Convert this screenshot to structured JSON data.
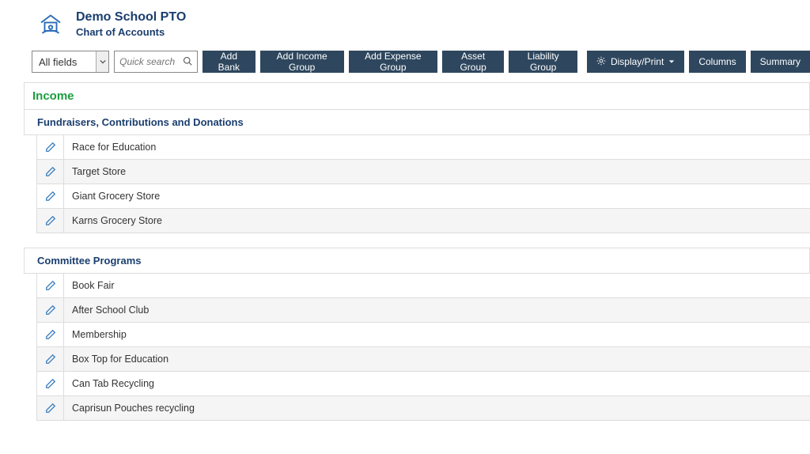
{
  "header": {
    "title": "Demo School PTO",
    "subtitle": "Chart of Accounts"
  },
  "toolbar": {
    "field_select": "All fields",
    "search_placeholder": "Quick search",
    "add_bank": "Add Bank",
    "add_income_group": "Add Income Group",
    "add_expense_group": "Add Expense Group",
    "asset_group": "Asset Group",
    "liability_group": "Liability Group",
    "display_print": "Display/Print",
    "columns": "Columns",
    "summary": "Summary"
  },
  "section": {
    "income_label": "Income",
    "groups": [
      {
        "name": "Fundraisers, Contributions and Donations",
        "items": [
          "Race for Education",
          "Target Store",
          "Giant Grocery Store",
          "Karns Grocery Store"
        ]
      },
      {
        "name": "Committee Programs",
        "items": [
          "Book Fair",
          "After School Club",
          "Membership",
          "Box Top for Education",
          "Can Tab Recycling",
          "Caprisun Pouches recycling"
        ]
      }
    ]
  }
}
